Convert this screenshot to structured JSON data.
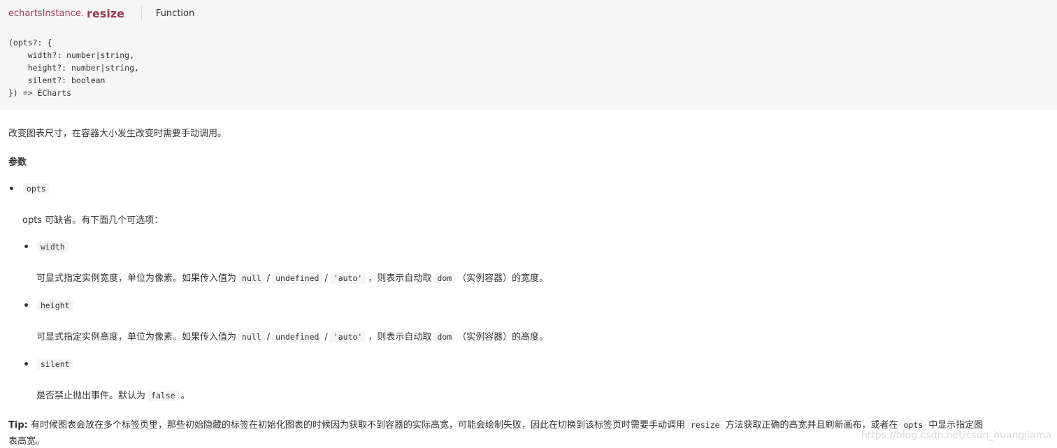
{
  "header": {
    "prefix": "echartsInstance.",
    "method": "resize",
    "kind": "Function"
  },
  "code": {
    "line1": "(opts?: {",
    "line2": "    width?: number|string,",
    "line3": "    height?: number|string,",
    "line4": "    silent?: boolean",
    "line5": "}) => ECharts"
  },
  "description": "改变图表尺寸，在容器大小发生改变时需要手动调用。",
  "params_heading": "参数",
  "opts": {
    "name": "opts",
    "desc": "opts 可缺省。有下面几个可选项："
  },
  "width": {
    "name": "width",
    "desc_before": "可显式指定实例宽度，单位为像素。如果传入值为",
    "v_null": "null",
    "slash1": "/",
    "v_undefined": "undefined",
    "slash2": "/",
    "v_auto": "'auto'",
    "desc_mid": "，则表示自动取",
    "v_dom": "dom",
    "desc_after": "（实例容器）的宽度。"
  },
  "height": {
    "name": "height",
    "desc_before": "可显式指定实例高度，单位为像素。如果传入值为",
    "v_null": "null",
    "slash1": "/",
    "v_undefined": "undefined",
    "slash2": "/",
    "v_auto": "'auto'",
    "desc_mid": "，则表示自动取",
    "v_dom": "dom",
    "desc_after": "（实例容器）的高度。"
  },
  "silent": {
    "name": "silent",
    "desc_before": "是否禁止抛出事件。默认为",
    "v_false": "false",
    "desc_after": "。"
  },
  "tip": {
    "label": "Tip:",
    "text1": "有时候图表会放在多个标签页里，那些初始隐藏的标签在初始化图表的时候因为获取不到容器的实际高宽，可能会绘制失败，因此在切换到该标签页时需要手动调用",
    "code1": "resize",
    "text2": "方法获取正确的高宽并且刷新画布，或者在",
    "code2": "opts",
    "text3": "中显示指定图",
    "text4": "表高宽。"
  },
  "watermark": "https://blog.csdn.net/csdn_huangjiama"
}
